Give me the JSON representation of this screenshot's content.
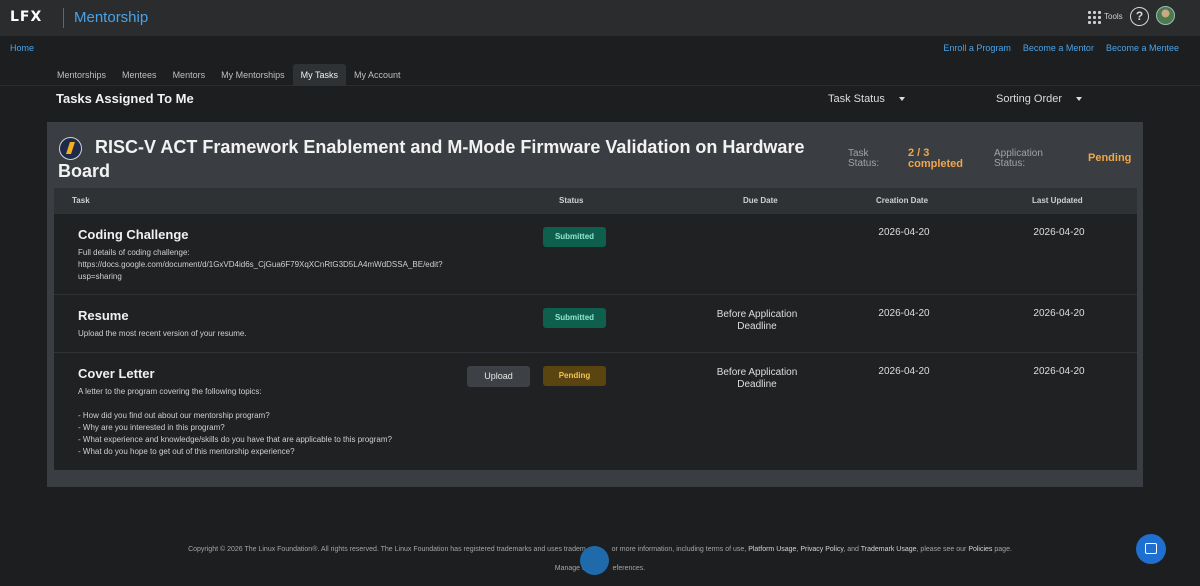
{
  "brand": {
    "logo": "LFX",
    "app_title": "Mentorship"
  },
  "topbar": {
    "tools_label": "Tools",
    "help_glyph": "?",
    "tools_icon": "grid-icon",
    "avatar": "user-avatar"
  },
  "nav": {
    "home": "Home",
    "links": [
      "Enroll a Program",
      "Become a Mentor",
      "Become a Mentee"
    ],
    "tabs": [
      "Mentorships",
      "Mentees",
      "Mentors",
      "My Mentorships",
      "My Tasks",
      "My Account"
    ],
    "active_tab": "My Tasks"
  },
  "page": {
    "heading": "Tasks Assigned To Me",
    "task_status_filter": "Task Status",
    "sorting_filter": "Sorting Order"
  },
  "program": {
    "title": "RISC-V ACT Framework Enablement and M-Mode Firmware Validation on Hardware Board",
    "task_status_label_1": "Task",
    "task_status_label_2": "Status:",
    "task_status_value_1": "2 / 3",
    "task_status_value_2": "completed",
    "app_status_label_1": "Application",
    "app_status_label_2": "Status:",
    "app_status_value": "Pending",
    "accent_color": "#f0a64a"
  },
  "table": {
    "headers": [
      "Task",
      "Status",
      "Due Date",
      "Creation Date",
      "Last Updated"
    ],
    "rows": [
      {
        "title": "Coding Challenge",
        "description": "Full details of coding challenge:\nhttps://docs.google.com/document/d/1GxVD4id6s_CjGua6F79XqXCnRtG3D5LA4mWdDSSA_BE/edit?\nusp=sharing",
        "status": "Submitted",
        "due_1": "",
        "due_2": "",
        "created": "2026-04-20",
        "updated": "2026-04-20"
      },
      {
        "title": "Resume",
        "description": "Upload the most recent version of your resume.",
        "status": "Submitted",
        "due_1": "Before Application",
        "due_2": "Deadline",
        "created": "2026-04-20",
        "updated": "2026-04-20"
      },
      {
        "title": "Cover Letter",
        "description": "A letter to the program covering the following topics:\n\n- How did you find out about our mentorship program?\n- Why are you interested in this program?\n- What experience and knowledge/skills do you have that are applicable to this program?\n- What do you hope to get out of this mentorship experience?",
        "status": "Pending",
        "action": "Upload",
        "due_1": "Before Application",
        "due_2": "Deadline",
        "created": "2026-04-20",
        "updated": "2026-04-20"
      }
    ]
  },
  "footer": {
    "copyright": "Copyright © 2026 The Linux Foundation®. All rights reserved. The Linux Foundation has registered trademarks and uses tradem",
    "copyright_tail": "or more information, including terms of use,",
    "links": [
      "Platform Usage",
      "Privacy Policy",
      "Trademark Usage"
    ],
    "sep_and": "and",
    "policies_pre": ", please see our",
    "policies_link": "Policies",
    "policies_post": "page.",
    "manage_pre": "Manage c",
    "manage_post": "eferences."
  }
}
